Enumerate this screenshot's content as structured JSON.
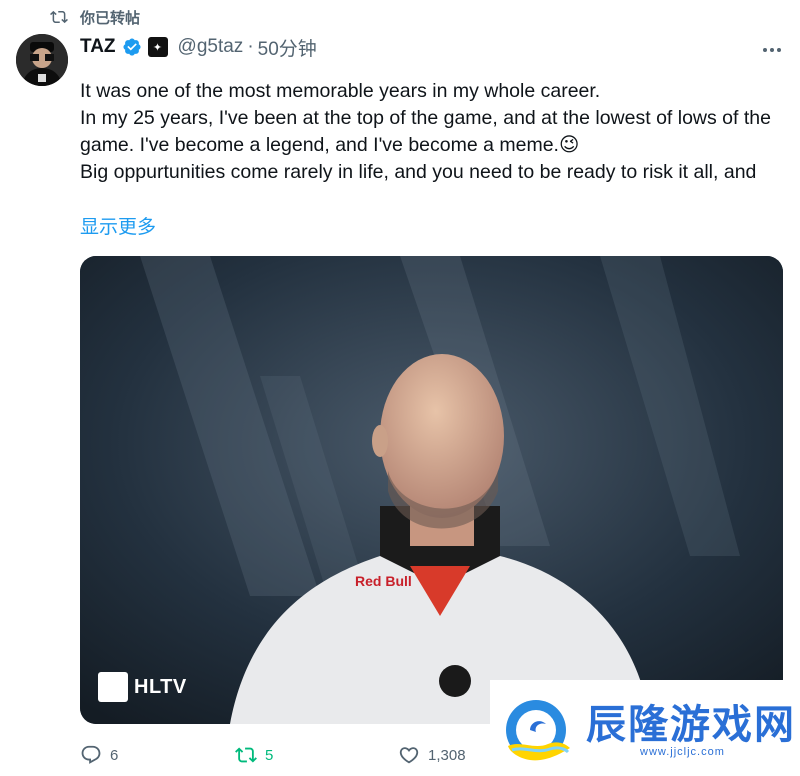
{
  "repost": {
    "label": "你已转帖"
  },
  "author": {
    "name": "TAZ",
    "handle": "@g5taz",
    "separator": "·",
    "time": "50分钟"
  },
  "tweet": {
    "lines": [
      "It was one of the most memorable years in my whole career.",
      "In my 25 years, I've been at the top of the game, and at the lowest of lows of the game. I've become a legend, and I've become a meme.😉",
      "Big oppurtunities come rarely in life, and you need to be ready to risk it all, and"
    ],
    "show_more": "显示更多"
  },
  "media": {
    "logo_text": "HLTV",
    "brand_text": "Red Bull"
  },
  "actions": {
    "replies": "6",
    "reposts": "5",
    "likes": "1,308"
  },
  "watermark": {
    "title": "辰隆游戏网",
    "url": "www.jjcljc.com"
  },
  "colors": {
    "accent": "#1d9bf0",
    "repost_green": "#00ba7c",
    "muted": "#536471",
    "watermark_blue": "#2a6fd6"
  }
}
